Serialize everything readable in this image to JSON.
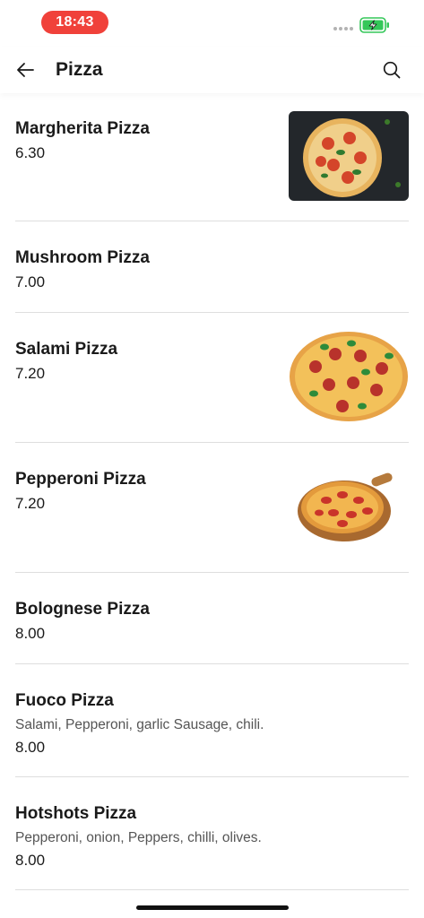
{
  "status_bar": {
    "time": "18:43",
    "battery_color": "#34c759",
    "time_pill_color": "#f0413a"
  },
  "header": {
    "title": "Pizza",
    "back_icon": "arrow-left-icon",
    "search_icon": "search-icon"
  },
  "items": [
    {
      "name": "Margherita Pizza",
      "description": "",
      "price": "6.30",
      "has_image": true,
      "image": "margherita-pizza-photo"
    },
    {
      "name": "Mushroom Pizza",
      "description": "",
      "price": "7.00",
      "has_image": false
    },
    {
      "name": "Salami Pizza",
      "description": "",
      "price": "7.20",
      "has_image": true,
      "image": "salami-pizza-photo"
    },
    {
      "name": "Pepperoni Pizza",
      "description": "",
      "price": "7.20",
      "has_image": true,
      "image": "pepperoni-pizza-photo"
    },
    {
      "name": "Bolognese Pizza",
      "description": "",
      "price": "8.00",
      "has_image": false
    },
    {
      "name": "Fuoco Pizza",
      "description": "Salami, Pepperoni, garlic Sausage, chili.",
      "price": "8.00",
      "has_image": false
    },
    {
      "name": "Hotshots Pizza",
      "description": "Pepperoni, onion, Peppers, chilli, olives.",
      "price": "8.00",
      "has_image": false
    }
  ]
}
